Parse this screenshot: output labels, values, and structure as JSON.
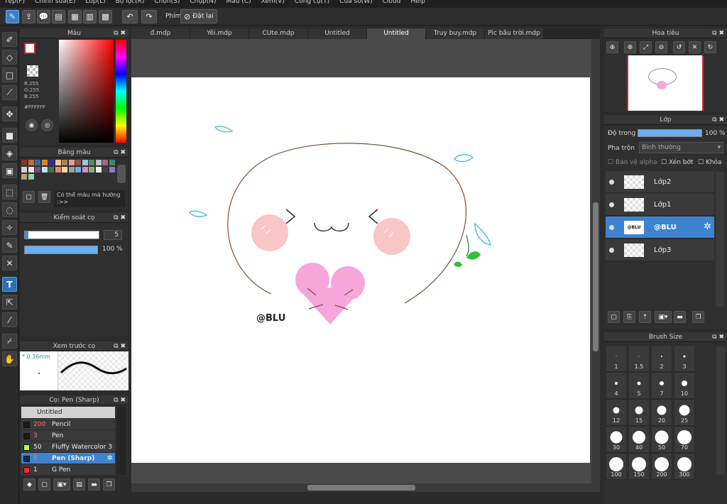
{
  "menu": [
    "Tệp(F)",
    "Chỉnh sửa(E)",
    "Lớp(L)",
    "Bộ lọc(R)",
    "Chọn(S)",
    "Chụp(N)",
    "Màu (C)",
    "Xem(V)",
    "Công cụ(T)",
    "Cửa sổ(W)",
    "Cloud",
    "Help"
  ],
  "toolbar": {
    "phim_label": "Phím",
    "reset_label": "Đặt lại"
  },
  "tabs": [
    "đ.mdp",
    "Yêi.mdp",
    "CUte.mdp",
    "Untitled",
    "Untitled",
    "Truy buy.mdp",
    "Pic bầu trời.mdp"
  ],
  "active_tab": 4,
  "color_panel": {
    "title": "Màu",
    "r": "R:255",
    "g": "G:255",
    "b": "B:255",
    "hex": "#FFFFFF"
  },
  "palette_panel": {
    "title": "Bảng màu",
    "hint": "Có thể màu mả hướng :>>"
  },
  "brush_control": {
    "title": "Kiểm soát cọ",
    "size": "5",
    "opacity": "100 %"
  },
  "brush_preview": {
    "title": "Xem trước cọ",
    "size_label": "* 0.36mm"
  },
  "brush_list": {
    "title": "Cọ: Pen (Sharp)",
    "group": "Untitled",
    "items": [
      {
        "size": "200",
        "name": "Pencil",
        "color": "#1a1a1a"
      },
      {
        "size": "3",
        "name": "Pen",
        "color": "#1a1a1a"
      },
      {
        "size": "50",
        "name": "Fluffy Watercolor 3",
        "color": "#b8ff3a"
      },
      {
        "size": "5",
        "name": "Pen (Sharp)",
        "color": "#14295a"
      },
      {
        "size": "1",
        "name": "G Pen",
        "color": "#ff2a2a"
      }
    ]
  },
  "canvas": {
    "signature": "@BLU"
  },
  "navigator": {
    "title": "Hoa tiêu"
  },
  "layers_panel": {
    "title": "Lớp",
    "opacity_label": "Độ trong",
    "opacity_value": "100 %",
    "blend_label": "Pha trộn",
    "blend_value": "Bình thường",
    "protect_alpha": "Bảo vệ alpha",
    "clipping": "Xén bớt",
    "lock": "Khóa",
    "layers": [
      {
        "name": "Lớp2"
      },
      {
        "name": "Lớp1"
      },
      {
        "name": "@BLU"
      },
      {
        "name": "Lớp3"
      }
    ],
    "selected_layer": 2
  },
  "brush_size_panel": {
    "title": "Brush Size",
    "sizes": [
      "1",
      "1.5",
      "2",
      "3",
      "4",
      "5",
      "7",
      "10",
      "12",
      "15",
      "20",
      "25",
      "30",
      "40",
      "50",
      "70",
      "100",
      "150",
      "200",
      "300"
    ]
  },
  "colors": {
    "accent": "#3d83cf",
    "paper": "#ffffff",
    "heart": "#f7a6dc",
    "cheek": "#f9c5c5",
    "outline": "#7a4f3a",
    "water": "#3ec0e8",
    "leaf": "#2fbf3a"
  }
}
